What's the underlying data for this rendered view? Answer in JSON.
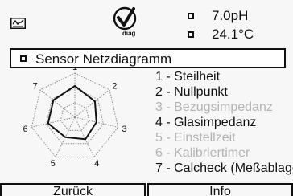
{
  "header": {
    "ph_value": "7.0pH",
    "temp_value": "24.1°C",
    "diag_label": "diag"
  },
  "title": {
    "label": "Sensor Netzdiagramm"
  },
  "radar": {
    "axis_labels": [
      "1",
      "2",
      "3",
      "4",
      "5",
      "6",
      "7"
    ],
    "active_axes": [
      1,
      2,
      4,
      6,
      7
    ],
    "values": [
      0.71,
      0.58,
      0.5,
      0.55,
      0.5,
      0.62,
      0.62
    ]
  },
  "parameters": [
    {
      "label": "1 - Steilheit",
      "active": true
    },
    {
      "label": "2 - Nullpunkt",
      "active": true
    },
    {
      "label": "3 - Bezugsimpedanz",
      "active": false
    },
    {
      "label": "4 - Glasimpedanz",
      "active": true
    },
    {
      "label": "5 - Einstellzeit",
      "active": false
    },
    {
      "label": "6 - Kalibriertimer",
      "active": false
    },
    {
      "label": "7 - Calcheck (Meßablage)",
      "active": true
    }
  ],
  "softkeys": {
    "left": "Zurück",
    "right": "Info"
  }
}
